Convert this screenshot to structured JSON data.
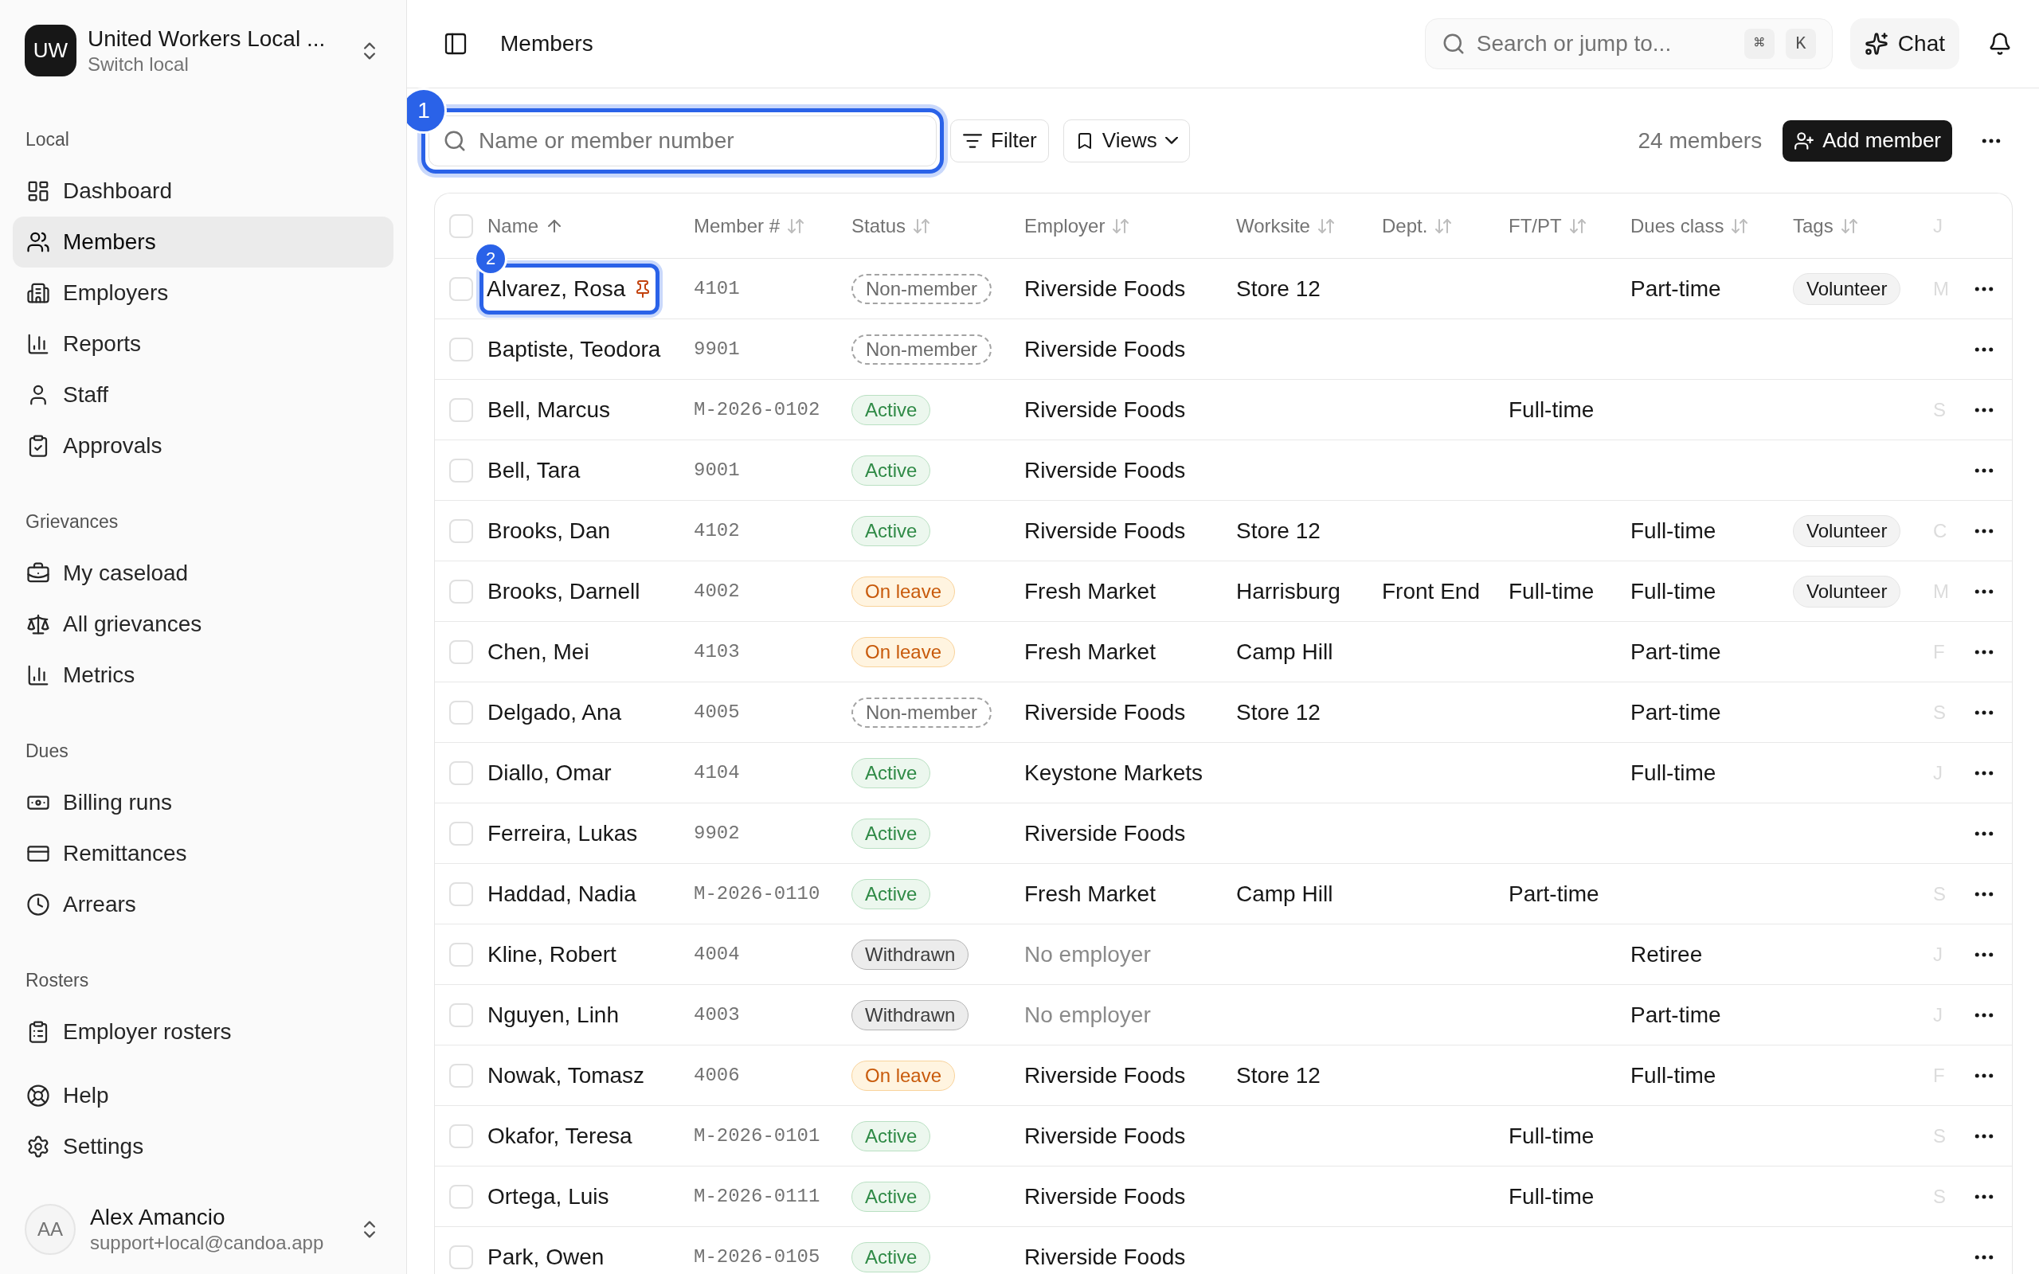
{
  "workspace": {
    "initials": "UW",
    "name": "United Workers Local ...",
    "subtitle": "Switch local"
  },
  "sidebar": {
    "sections": [
      {
        "label": "Local",
        "items": [
          {
            "label": "Dashboard",
            "selected": false
          },
          {
            "label": "Members",
            "selected": true
          },
          {
            "label": "Employers",
            "selected": false
          },
          {
            "label": "Reports",
            "selected": false
          },
          {
            "label": "Staff",
            "selected": false
          },
          {
            "label": "Approvals",
            "selected": false
          }
        ]
      },
      {
        "label": "Grievances",
        "items": [
          {
            "label": "My caseload",
            "selected": false
          },
          {
            "label": "All grievances",
            "selected": false
          },
          {
            "label": "Metrics",
            "selected": false
          }
        ]
      },
      {
        "label": "Dues",
        "items": [
          {
            "label": "Billing runs",
            "selected": false
          },
          {
            "label": "Remittances",
            "selected": false
          },
          {
            "label": "Arrears",
            "selected": false
          }
        ]
      },
      {
        "label": "Rosters",
        "items": [
          {
            "label": "Employer rosters",
            "selected": false
          }
        ]
      }
    ],
    "footer_items": [
      {
        "label": "Help",
        "selected": false
      },
      {
        "label": "Settings",
        "selected": false
      }
    ]
  },
  "user": {
    "initials": "AA",
    "name": "Alex Amancio",
    "email": "support+local@candoa.app"
  },
  "header": {
    "title": "Members",
    "search": {
      "placeholder": "Search or jump to...",
      "keys": [
        "⌘",
        "K"
      ]
    },
    "chat": "Chat"
  },
  "toolbar": {
    "search": {
      "placeholder": "Name or member number",
      "marker": "1"
    },
    "filter": "Filter",
    "views": "Views",
    "count": "24 members",
    "add": "Add member"
  },
  "table": {
    "select_all": {
      "checked": false
    },
    "columns": [
      {
        "label": "Name",
        "sorted": true
      },
      {
        "label": "Member #",
        "sorted": false
      },
      {
        "label": "Status",
        "sorted": false
      },
      {
        "label": "Employer",
        "sorted": false
      },
      {
        "label": "Worksite",
        "sorted": false
      },
      {
        "label": "Dept.",
        "sorted": false
      },
      {
        "label": "FT/PT",
        "sorted": false
      },
      {
        "label": "Dues class",
        "sorted": false
      },
      {
        "label": "Tags",
        "sorted": false
      },
      {
        "label": "J"
      }
    ],
    "name_marker": "2",
    "rows": [
      {
        "checked": false,
        "name": "Alvarez, Rosa",
        "pinned": true,
        "member_no": "4101",
        "status": {
          "label": "Non-member",
          "kind": "nonmember"
        },
        "employer": "Riverside Foods",
        "employer_missing": false,
        "worksite": "Store 12",
        "dept": "",
        "ftpt": "",
        "dues": "Part-time",
        "tags": [
          "Volunteer"
        ],
        "column_10": "M"
      },
      {
        "checked": false,
        "name": "Baptiste, Teodora",
        "pinned": false,
        "member_no": "9901",
        "status": {
          "label": "Non-member",
          "kind": "nonmember"
        },
        "employer": "Riverside Foods",
        "employer_missing": false,
        "worksite": "",
        "dept": "",
        "ftpt": "",
        "dues": "",
        "tags": [],
        "column_10": ""
      },
      {
        "checked": false,
        "name": "Bell, Marcus",
        "pinned": false,
        "member_no": "M-2026-0102",
        "status": {
          "label": "Active",
          "kind": "active"
        },
        "employer": "Riverside Foods",
        "employer_missing": false,
        "worksite": "",
        "dept": "",
        "ftpt": "Full-time",
        "dues": "",
        "tags": [],
        "column_10": "S"
      },
      {
        "checked": false,
        "name": "Bell, Tara",
        "pinned": false,
        "member_no": "9001",
        "status": {
          "label": "Active",
          "kind": "active"
        },
        "employer": "Riverside Foods",
        "employer_missing": false,
        "worksite": "",
        "dept": "",
        "ftpt": "",
        "dues": "",
        "tags": [],
        "column_10": ""
      },
      {
        "checked": false,
        "name": "Brooks, Dan",
        "pinned": false,
        "member_no": "4102",
        "status": {
          "label": "Active",
          "kind": "active"
        },
        "employer": "Riverside Foods",
        "employer_missing": false,
        "worksite": "Store 12",
        "dept": "",
        "ftpt": "",
        "dues": "Full-time",
        "tags": [
          "Volunteer"
        ],
        "column_10": "C"
      },
      {
        "checked": false,
        "name": "Brooks, Darnell",
        "pinned": false,
        "member_no": "4002",
        "status": {
          "label": "On leave",
          "kind": "leave"
        },
        "employer": "Fresh Market",
        "employer_missing": false,
        "worksite": "Harrisburg",
        "dept": "Front End",
        "ftpt": "Full-time",
        "dues": "Full-time",
        "tags": [
          "Volunteer"
        ],
        "column_10": "M"
      },
      {
        "checked": false,
        "name": "Chen, Mei",
        "pinned": false,
        "member_no": "4103",
        "status": {
          "label": "On leave",
          "kind": "leave"
        },
        "employer": "Fresh Market",
        "employer_missing": false,
        "worksite": "Camp Hill",
        "dept": "",
        "ftpt": "",
        "dues": "Part-time",
        "tags": [],
        "column_10": "F"
      },
      {
        "checked": false,
        "name": "Delgado, Ana",
        "pinned": false,
        "member_no": "4005",
        "status": {
          "label": "Non-member",
          "kind": "nonmember"
        },
        "employer": "Riverside Foods",
        "employer_missing": false,
        "worksite": "Store 12",
        "dept": "",
        "ftpt": "",
        "dues": "Part-time",
        "tags": [],
        "column_10": "S"
      },
      {
        "checked": false,
        "name": "Diallo, Omar",
        "pinned": false,
        "member_no": "4104",
        "status": {
          "label": "Active",
          "kind": "active"
        },
        "employer": "Keystone Markets",
        "employer_missing": false,
        "worksite": "",
        "dept": "",
        "ftpt": "",
        "dues": "Full-time",
        "tags": [],
        "column_10": "J"
      },
      {
        "checked": false,
        "name": "Ferreira, Lukas",
        "pinned": false,
        "member_no": "9902",
        "status": {
          "label": "Active",
          "kind": "active"
        },
        "employer": "Riverside Foods",
        "employer_missing": false,
        "worksite": "",
        "dept": "",
        "ftpt": "",
        "dues": "",
        "tags": [],
        "column_10": ""
      },
      {
        "checked": false,
        "name": "Haddad, Nadia",
        "pinned": false,
        "member_no": "M-2026-0110",
        "status": {
          "label": "Active",
          "kind": "active"
        },
        "employer": "Fresh Market",
        "employer_missing": false,
        "worksite": "Camp Hill",
        "dept": "",
        "ftpt": "Part-time",
        "dues": "",
        "tags": [],
        "column_10": "S"
      },
      {
        "checked": false,
        "name": "Kline, Robert",
        "pinned": false,
        "member_no": "4004",
        "status": {
          "label": "Withdrawn",
          "kind": "withdrawn"
        },
        "employer": "No employer",
        "employer_missing": true,
        "worksite": "",
        "dept": "",
        "ftpt": "",
        "dues": "Retiree",
        "tags": [],
        "column_10": "J"
      },
      {
        "checked": false,
        "name": "Nguyen, Linh",
        "pinned": false,
        "member_no": "4003",
        "status": {
          "label": "Withdrawn",
          "kind": "withdrawn"
        },
        "employer": "No employer",
        "employer_missing": true,
        "worksite": "",
        "dept": "",
        "ftpt": "",
        "dues": "Part-time",
        "tags": [],
        "column_10": "J"
      },
      {
        "checked": false,
        "name": "Nowak, Tomasz",
        "pinned": false,
        "member_no": "4006",
        "status": {
          "label": "On leave",
          "kind": "leave"
        },
        "employer": "Riverside Foods",
        "employer_missing": false,
        "worksite": "Store 12",
        "dept": "",
        "ftpt": "",
        "dues": "Full-time",
        "tags": [],
        "column_10": "F"
      },
      {
        "checked": false,
        "name": "Okafor, Teresa",
        "pinned": false,
        "member_no": "M-2026-0101",
        "status": {
          "label": "Active",
          "kind": "active"
        },
        "employer": "Riverside Foods",
        "employer_missing": false,
        "worksite": "",
        "dept": "",
        "ftpt": "Full-time",
        "dues": "",
        "tags": [],
        "column_10": "S"
      },
      {
        "checked": false,
        "name": "Ortega, Luis",
        "pinned": false,
        "member_no": "M-2026-0111",
        "status": {
          "label": "Active",
          "kind": "active"
        },
        "employer": "Riverside Foods",
        "employer_missing": false,
        "worksite": "",
        "dept": "",
        "ftpt": "Full-time",
        "dues": "",
        "tags": [],
        "column_10": "S"
      },
      {
        "checked": false,
        "name": "Park, Owen",
        "pinned": false,
        "member_no": "M-2026-0105",
        "status": {
          "label": "Active",
          "kind": "active"
        },
        "employer": "Riverside Foods",
        "employer_missing": false,
        "worksite": "",
        "dept": "",
        "ftpt": "",
        "dues": "",
        "tags": [],
        "column_10": ""
      }
    ]
  }
}
